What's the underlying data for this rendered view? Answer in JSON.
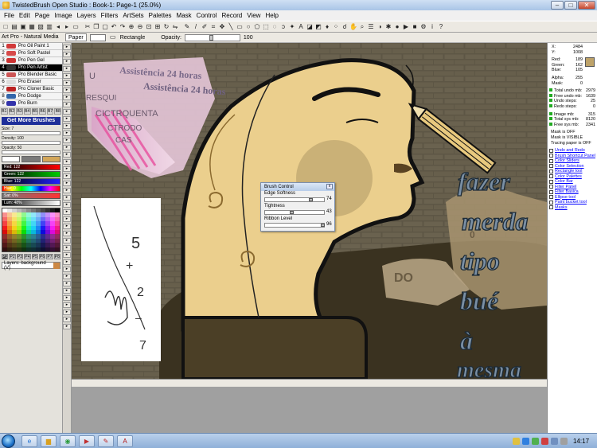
{
  "window": {
    "title": "TwistedBrush Open Studio : Book-1: Page-1 (25.0%)",
    "min_label": "–",
    "max_label": "□",
    "close_label": "✕"
  },
  "menu": [
    "File",
    "Edit",
    "Page",
    "Image",
    "Layers",
    "Filters",
    "ArtSets",
    "Palettes",
    "Mask",
    "Control",
    "Record",
    "View",
    "Help"
  ],
  "options_bar": {
    "preset": "Art Pro - Natural Media",
    "paper_label": "Paper",
    "tool_label": "Rectangle",
    "opacity_label": "Opacity:",
    "opacity_value": "100"
  },
  "brushes": [
    {
      "num": "1",
      "name": "Pro Oil Paint 1",
      "color": "#d23a3a"
    },
    {
      "num": "2",
      "name": "Pro Soft Pastel",
      "color": "#d64a4a"
    },
    {
      "num": "3",
      "name": "Pro Pen Gel",
      "color": "#c33"
    },
    {
      "num": "4",
      "name": "Pro Pen Artist",
      "color": "#333",
      "selected": true
    },
    {
      "num": "5",
      "name": "Pro Blender Basic",
      "color": "#c55"
    },
    {
      "num": "6",
      "name": "Pro Eraser",
      "color": "#ddd"
    },
    {
      "num": "7",
      "name": "Pro Cloner Basic",
      "color": "#b22"
    },
    {
      "num": "8",
      "name": "Pro Dodge",
      "color": "#36a"
    },
    {
      "num": "9",
      "name": "Pro Burn",
      "color": "#33a"
    }
  ],
  "brush_pages": [
    "B1",
    "B2",
    "B3",
    "B4",
    "B5",
    "B6",
    "B7",
    "B8"
  ],
  "get_more_label": "Get More Brushes",
  "size_label": "Size: 7",
  "density_label": "Density: 100",
  "opacity_small_label": "Opacity: 50",
  "color_bars": {
    "red": "Red: 122",
    "green": "Green: 122",
    "blue": "Blue: 122",
    "hue": "Hue: 0",
    "sat": "Sat: 0%",
    "lum": "Lum: 48%"
  },
  "palette_tabs": [
    "P1",
    "P2",
    "P3",
    "P4",
    "P5",
    "P6",
    "P7",
    "P8"
  ],
  "layers_label": "Layers: background (V)",
  "brush_control": {
    "title": "Brush Control",
    "close_label": "x",
    "sliders": [
      {
        "label": "Edge Softness",
        "value": "74"
      },
      {
        "label": "Tightness",
        "value": "43"
      },
      {
        "label": "Ribbon Level",
        "value": "96"
      }
    ]
  },
  "info": {
    "x_label": "X:",
    "x": "2484",
    "y_label": "Y:",
    "y": "1008",
    "red_label": "Red:",
    "red": "189",
    "green_label": "Green:",
    "green": "162",
    "blue_label": "Blue:",
    "blue": "105",
    "alpha_label": "Alpha:",
    "alpha": "255",
    "mask_label": "Mask:",
    "mask": "0",
    "total_undo_label": "Total undo mb:",
    "total_undo": "2979",
    "free_undo_label": "Free undo mb:",
    "free_undo": "1639",
    "undo_steps_label": "Undo steps:",
    "undo_steps": "25",
    "redo_steps_label": "Redo steps:",
    "redo_steps": "0",
    "image_mb_label": "Image mb:",
    "image_mb": "315",
    "total_sys_label": "Total sys mb:",
    "total_sys": "8120",
    "free_sys_label": "Free sys mb:",
    "free_sys": "2341",
    "mask_off": "Mask is OFF",
    "mask_visible": "Mask is VISIBLE",
    "tracing_off": "Tracing paper is OFF",
    "sample_color": "#bda269"
  },
  "panel_links": [
    "Undo and Redo",
    "Brush Shortcut Panel",
    "Color Sliders",
    "Color Selection",
    "Rectangle tool",
    "Color Palettes",
    "Color Bar",
    "Filter Panel",
    "Filter Basica",
    "Ellipse tool",
    "Paint bucket tool",
    "Masks"
  ],
  "artwork": {
    "poster_line1": "Assistência 24 horas",
    "poster_line2": "Assistência 24 horas",
    "poster_words": [
      "U",
      "RESQUI",
      "CICTRQUENTA",
      "CTRODO",
      "CAS"
    ],
    "hand_numbers": [
      "5",
      "+",
      "2",
      "–",
      "7"
    ],
    "stamp_text": "DO",
    "fragment_text": "0",
    "words": [
      "fazer",
      "merda",
      "tipo",
      "bué",
      "à",
      "mesma"
    ]
  },
  "taskbar": {
    "clock": "14:17"
  }
}
